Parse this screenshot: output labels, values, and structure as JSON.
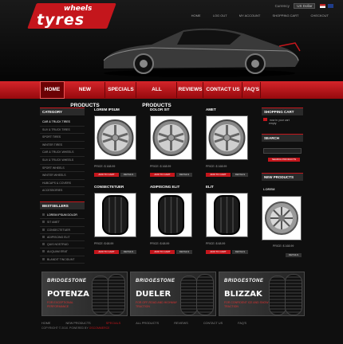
{
  "logo": {
    "small": "wheels",
    "big": "tyres"
  },
  "topbar": {
    "currency_label": "Currency",
    "currency_value": "US Dollar"
  },
  "topnav": [
    "HOME",
    "LOG OUT",
    "MY ACCOUNT",
    "SHOPPING CART",
    "CHECKOUT"
  ],
  "nav": [
    "HOME",
    "NEW PRODUCTS",
    "SPECIALS",
    "ALL PRODUCTS",
    "REVIEWS",
    "CONTACT US",
    "FAQ'S"
  ],
  "category": {
    "title": "CATEGORY",
    "items": [
      "CAR & TRUCK TIRES",
      "SUV & TRUCK TIRES",
      "SPORT TIRES",
      "WINTER TIRES",
      "CAR & TRUCK WHEELS",
      "SUV & TRUCK WHEELS",
      "SPORT WHEELS",
      "WINTER WHEELS",
      "HUBCAPS & COVERS",
      "ACCESSORIES"
    ]
  },
  "bestsellers": {
    "title": "BESTSELLERS",
    "items": [
      "LOREM IPSUM DOLOR",
      "SIT AMET",
      "CONSECTETUER",
      "ADIPISCING ELIT",
      "QUIS NOSTRUD",
      "ALIQUAM ERAT",
      "BLANDIT TINCIDUNT"
    ]
  },
  "products": [
    {
      "name": "LOREM IPSUM",
      "price": "PRICE: $ 168.99",
      "kind": "wheel"
    },
    {
      "name": "DOLOR SIT",
      "price": "PRICE: $ 168.99",
      "kind": "wheel"
    },
    {
      "name": "AMET",
      "price": "PRICE: $ 168.99",
      "kind": "wheel"
    },
    {
      "name": "CONSECTETUER",
      "price": "PRICE: $ 68.99",
      "kind": "tire"
    },
    {
      "name": "ADIPISCING ELIT",
      "price": "PRICE: $ 68.99",
      "kind": "tire"
    },
    {
      "name": "ELIT",
      "price": "PRICE: $ 68.99",
      "kind": "tire"
    }
  ],
  "buttons": {
    "add": "ADD TO CART",
    "details": "DETAILS"
  },
  "right": {
    "cart_title": "SHOPPING CART",
    "cart_text": "now in your cart",
    "cart_empty": "empty",
    "search_title": "SEARCH",
    "search_button": "SEARCH PRODUCTS",
    "new_title": "NEW PRODUCTS",
    "new_name": "LOREM",
    "new_price": "PRICE: $ 168.99"
  },
  "banners": [
    {
      "brand": "BRIDGESTONE",
      "name": "POTENZA",
      "sub": "FOR EXCEPTIONAL PERFORMANCE"
    },
    {
      "brand": "BRIDGESTONE",
      "name": "DUELER",
      "sub": "FOR OFF-ROAD AND HIGHWAY TRACTION"
    },
    {
      "brand": "BRIDGESTONE",
      "name": "BLIZZAK",
      "sub": "FOR CONFIDENT ICE AND SNOW TRACTION"
    }
  ],
  "footer": {
    "links": [
      "HOME",
      "NEW PRODUCTS",
      "SPECIALS",
      "ALL PRODUCTS",
      "REVIEWS",
      "CONTACT US",
      "FAQ'S"
    ],
    "copyright": "COPYRIGHT © 2010. POWERED BY",
    "powered": "OSCOMMERCE"
  },
  "colors": {
    "accent": "#c4161c",
    "background": "#0f0f0f"
  }
}
